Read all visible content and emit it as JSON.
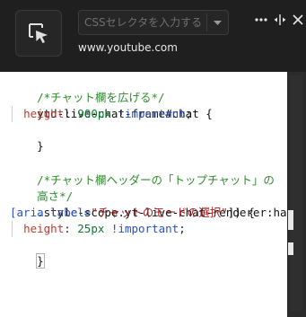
{
  "toolbar": {
    "selector_placeholder": "CSSセレクタを入力する...",
    "url": "www.youtube.com",
    "more_label": "•••",
    "split_label": "⇔",
    "close_label": "✕"
  },
  "editor": {
    "lines": [
      {
        "comment": "/*チャット欄を広げる*/"
      },
      {
        "selector": "ytd-live-chat-frame#chat {"
      },
      {
        "prop": "height",
        "value": "900px",
        "important": "!important"
      },
      {
        "close": "}"
      },
      {
        "comment": "/*チャット欄ヘッダーの「トップチャット」の"
      },
      {
        "comment": "高さ*/"
      },
      {
        "selector": ".style-scope.yt-live-chat-renderer:has("
      },
      {
        "attr_open": "[aria-label=",
        "attr_value": "\"チャットのモードの選択\"",
        "attr_close": "]) {"
      },
      {
        "prop": "height",
        "value": "25px",
        "important": "!important"
      },
      {
        "close": "}"
      }
    ]
  }
}
